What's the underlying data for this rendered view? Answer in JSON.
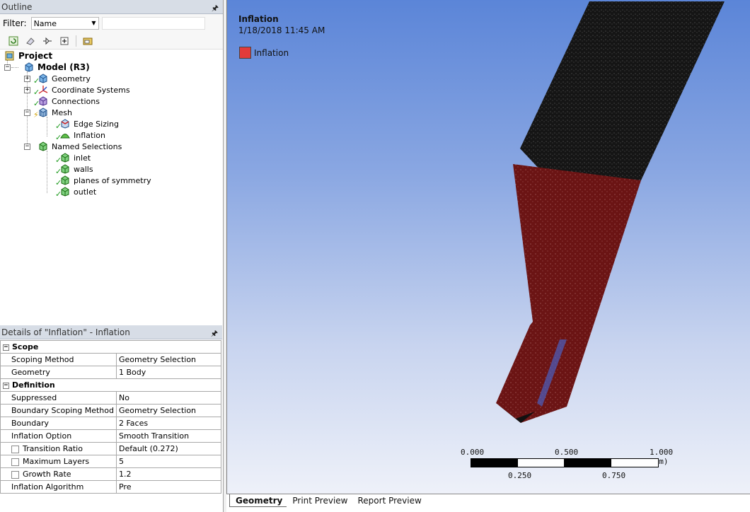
{
  "outline": {
    "title": "Outline",
    "filter_label": "Filter:",
    "filter_value": "Name",
    "filter_text": "",
    "tree": {
      "project": "Project",
      "model": "Model (R3)",
      "geometry": "Geometry",
      "coordinate_systems": "Coordinate Systems",
      "connections": "Connections",
      "mesh": "Mesh",
      "edge_sizing": "Edge Sizing",
      "inflation": "Inflation",
      "named_selections": "Named Selections",
      "inlet": "inlet",
      "walls": "walls",
      "planes_of_symmetry": "planes of symmetry",
      "outlet": "outlet"
    }
  },
  "details": {
    "title": "Details of \"Inflation\" - Inflation",
    "scope": {
      "label": "Scope",
      "rows": [
        {
          "prop": "Scoping Method",
          "value": "Geometry Selection"
        },
        {
          "prop": "Geometry",
          "value": "1 Body"
        }
      ]
    },
    "definition": {
      "label": "Definition",
      "rows": [
        {
          "prop": "Suppressed",
          "value": "No"
        },
        {
          "prop": "Boundary Scoping Method",
          "value": "Geometry Selection"
        },
        {
          "prop": "Boundary",
          "value": "2 Faces"
        },
        {
          "prop": "Inflation Option",
          "value": "Smooth Transition"
        },
        {
          "prop": "Transition Ratio",
          "value": "Default (0.272)"
        },
        {
          "prop": "Maximum Layers",
          "value": "5"
        },
        {
          "prop": "Growth Rate",
          "value": "1.2"
        },
        {
          "prop": "Inflation Algorithm",
          "value": "Pre"
        }
      ]
    }
  },
  "viewport": {
    "title": "Inflation",
    "date": "1/18/2018 11:45 AM",
    "legend_label": "Inflation",
    "legend_color": "#e23b3b",
    "scale": {
      "top_labels": [
        "0.000",
        "0.500",
        "1.000 (mm)"
      ],
      "bottom_labels": [
        "0.250",
        "0.750"
      ]
    }
  },
  "tabs": [
    "Geometry",
    "Print Preview",
    "Report Preview"
  ],
  "colors": {
    "mesh_dark": "#1a1a1a",
    "mesh_red": "#6b1414",
    "viewport_top": "#5b85d8"
  }
}
